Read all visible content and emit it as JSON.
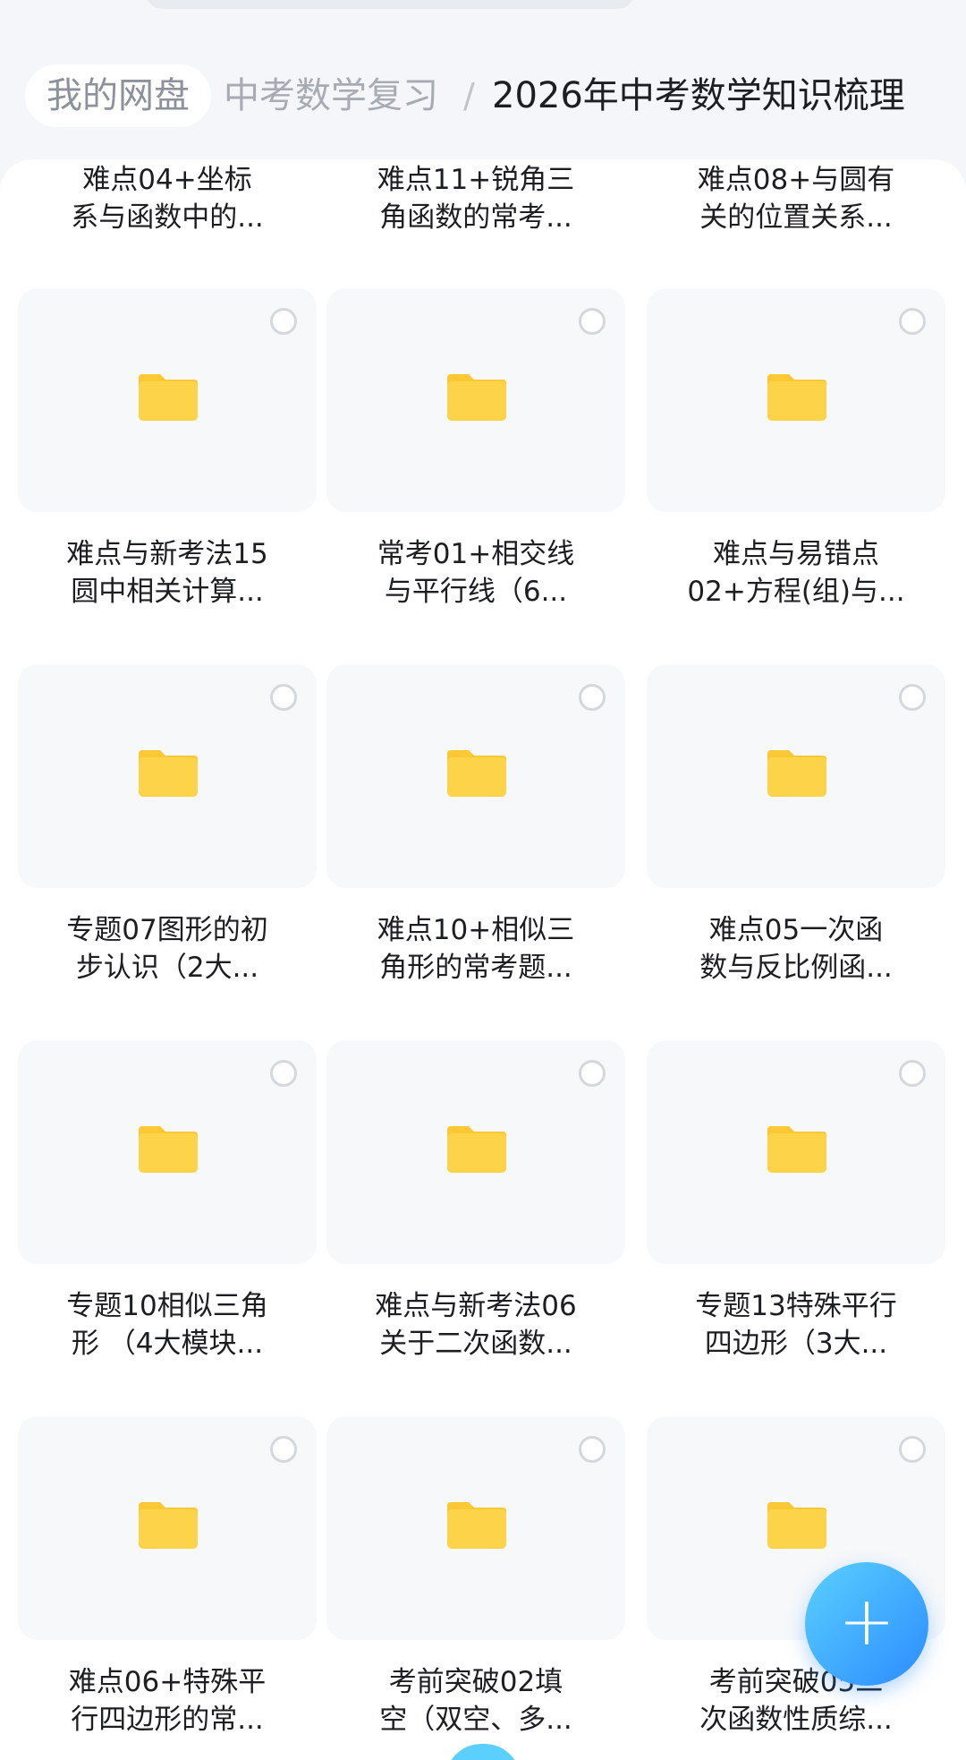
{
  "breadcrumb": {
    "home": "我的网盘",
    "middle": "中考数学复习",
    "separator": "/",
    "current": "2026年中考数学知识梳理"
  },
  "folders_partial": [
    {
      "name": "难点04+坐标\n系与函数中的..."
    },
    {
      "name": "难点11+锐角三\n角函数的常考..."
    },
    {
      "name": "难点08+与圆有\n关的位置关系..."
    }
  ],
  "folders": [
    {
      "name": "难点与新考法15\n圆中相关计算..."
    },
    {
      "name": "常考01+相交线\n与平行线（6..."
    },
    {
      "name": "难点与易错点\n02+方程(组)与..."
    },
    {
      "name": "专题07图形的初\n步认识（2大..."
    },
    {
      "name": "难点10+相似三\n角形的常考题..."
    },
    {
      "name": "难点05一次函\n数与反比例函..."
    },
    {
      "name": "专题10相似三角\n形 （4大模块..."
    },
    {
      "name": "难点与新考法06\n关于二次函数..."
    },
    {
      "name": "专题13特殊平行\n四边形（3大..."
    },
    {
      "name": "难点06+特殊平\n行四边形的常..."
    },
    {
      "name": "考前突破02填\n空（双空、多..."
    },
    {
      "name": "考前突破05二\n次函数性质综..."
    }
  ],
  "fab": {
    "symbol": "+"
  },
  "colors": {
    "folder": "#fdd449",
    "folder_tab": "#fcc934",
    "fab_start": "#5bd0ff",
    "fab_end": "#2b8cff",
    "text": "#1c1e21",
    "muted": "#8d9199"
  },
  "icons": {
    "folder": "folder-icon",
    "select": "select-circle-icon",
    "add": "plus-icon"
  }
}
